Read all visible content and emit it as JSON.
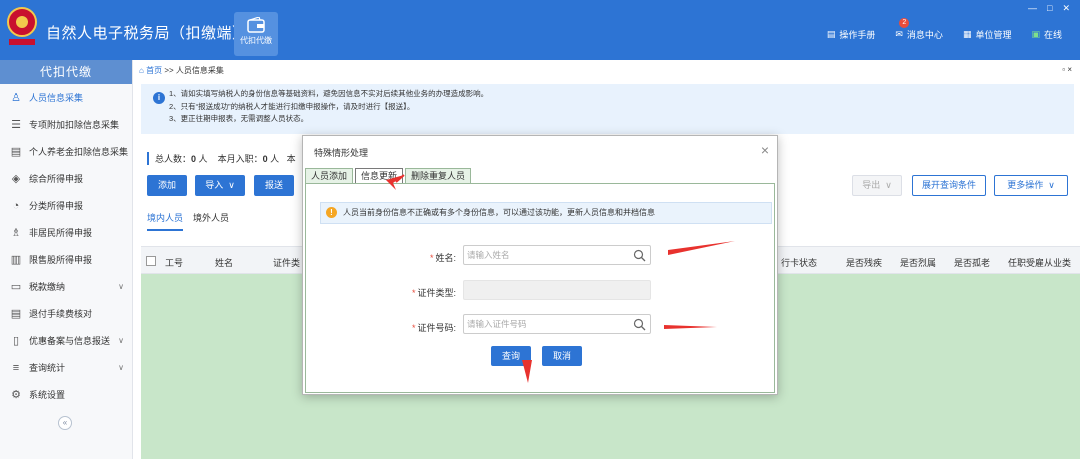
{
  "header": {
    "title": "自然人电子税务局（扣缴端）",
    "module_label": "代扣代缴",
    "links": [
      {
        "label": "操作手册",
        "icon": "manual-icon"
      },
      {
        "label": "消息中心",
        "icon": "mail-icon",
        "badge": "2"
      },
      {
        "label": "单位管理",
        "icon": "org-icon"
      },
      {
        "label": "在线",
        "icon": "online-icon"
      }
    ],
    "window_controls": [
      "—",
      "□",
      "✕"
    ]
  },
  "sidebar": {
    "title": "代扣代缴",
    "items": [
      {
        "label": "人员信息采集",
        "active": true
      },
      {
        "label": "专项附加扣除信息采集"
      },
      {
        "label": "个人养老金扣除信息采集"
      },
      {
        "label": "综合所得申报"
      },
      {
        "label": "分类所得申报"
      },
      {
        "label": "非居民所得申报"
      },
      {
        "label": "限售股所得申报"
      },
      {
        "label": "税款缴纳",
        "expandable": true
      },
      {
        "label": "退付手续费核对"
      },
      {
        "label": "优惠备案与信息报送",
        "expandable": true
      },
      {
        "label": "查询统计",
        "expandable": true
      },
      {
        "label": "系统设置"
      }
    ],
    "collapse_label": "«"
  },
  "main": {
    "breadcrumb_home": "首页",
    "breadcrumb_sep": ">>",
    "breadcrumb_current": "人员信息采集",
    "panel_controls": "▫ ×",
    "notices": [
      "1、请如实填写纳税人的身份信息等基础资料，避免因信息不实对后续其他业务的办理造成影响。",
      "2、只有“报送成功”的纳税人才能进行扣缴申报操作，请及时进行【报送】。",
      "3、更正往期申报表，无需调整人员状态。"
    ],
    "stats": {
      "total_label": "总人数：",
      "total_value": "0",
      "unit": "人",
      "month_label": "本月入职：",
      "month_value": "0",
      "more": "本"
    },
    "buttons": {
      "add": "添加",
      "import": "导入",
      "submit": "报送",
      "export": "导出",
      "expand_query": "展开查询条件",
      "more_ops": "更多操作"
    },
    "tabs": [
      "境内人员",
      "境外人员"
    ],
    "columns": [
      "工号",
      "姓名",
      "证件类",
      "行卡状态",
      "是否残疾",
      "是否烈属",
      "是否孤老",
      "任职受雇从业类"
    ]
  },
  "modal": {
    "title": "特殊情形处理",
    "close": "×",
    "tabs": [
      "人员添加",
      "信息更新",
      "删除重复人员"
    ],
    "active_tab": 1,
    "warning": "人员当前身份信息不正确或有多个身份信息，可以通过该功能，更新人员信息和并档信息",
    "fields": {
      "name_label": "姓名:",
      "name_placeholder": "请输入姓名",
      "idtype_label": "证件类型:",
      "idno_label": "证件号码:",
      "idno_placeholder": "请输入证件号码"
    },
    "buttons": {
      "query": "查询",
      "cancel": "取消"
    }
  },
  "colors": {
    "brand": "#2d74d4",
    "arrow": "#e8322e",
    "table_body": "#c8e6c9"
  }
}
